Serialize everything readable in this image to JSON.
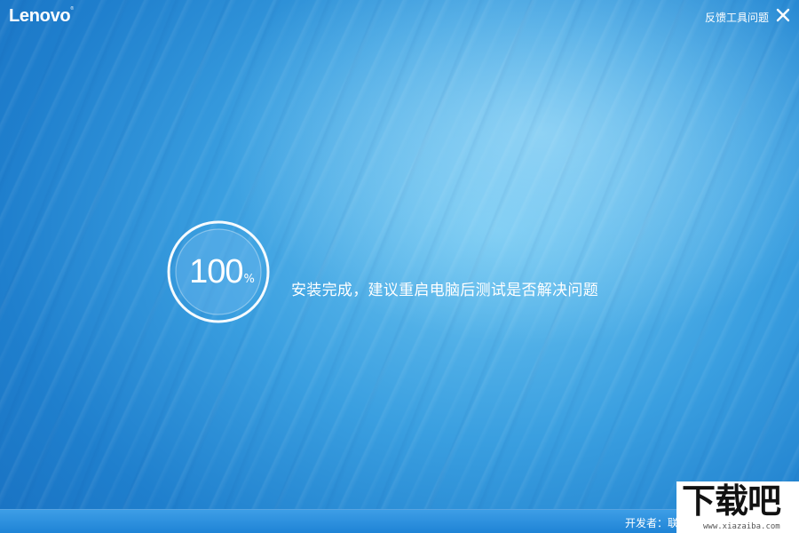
{
  "header": {
    "logo_text": "Lenovo",
    "logo_mark": "®",
    "feedback_label": "反馈工具问题",
    "close_icon": "close-icon"
  },
  "progress": {
    "value": "100",
    "unit": "%",
    "fraction": 1.0
  },
  "message": "安装完成，建议重启电脑后测试是否解决问题",
  "footer": {
    "developer_label": "开发者：联"
  },
  "watermark": {
    "main": "下载吧",
    "sub": "www.xiazaiba.com"
  },
  "colors": {
    "background_blue": "#2a8fd8",
    "text": "#ffffff"
  }
}
